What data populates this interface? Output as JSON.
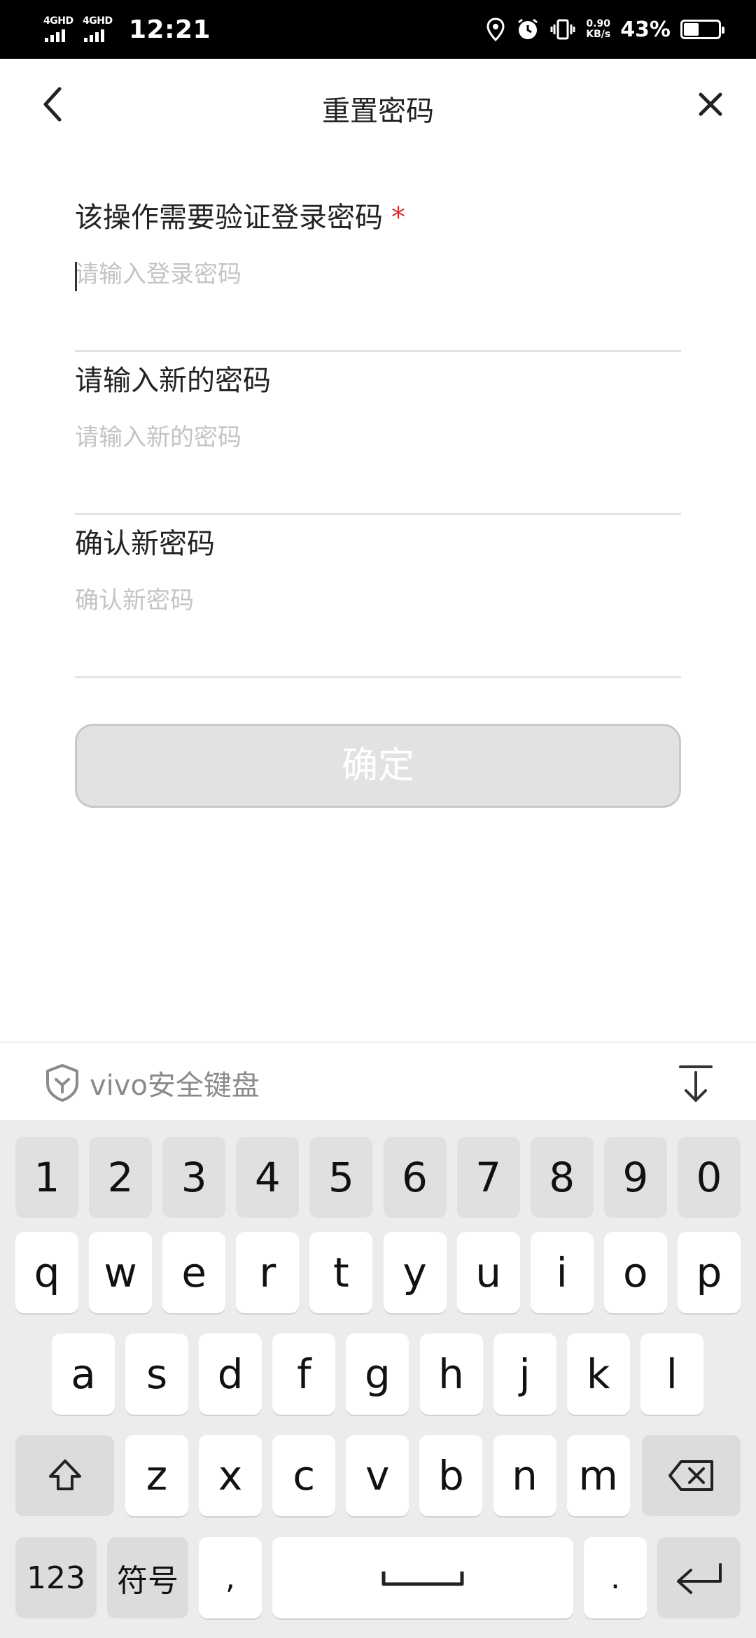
{
  "status_bar": {
    "sim1_label": "4GHD",
    "sim2_label": "4GHD",
    "time": "12:21",
    "speed_value": "0.90",
    "speed_unit": "KB/s",
    "battery_percent": "43%",
    "battery_level": 0.43,
    "icons": [
      "location-icon",
      "alarm-icon",
      "vibrate-icon"
    ]
  },
  "header": {
    "title": "重置密码",
    "back_icon": "chevron-left-icon",
    "close_icon": "close-icon"
  },
  "form": {
    "fields": [
      {
        "label": "该操作需要验证登录密码",
        "required_mark": "*",
        "placeholder": "请输入登录密码",
        "value": ""
      },
      {
        "label": "请输入新的密码",
        "placeholder": "请输入新的密码",
        "value": ""
      },
      {
        "label": "确认新密码",
        "placeholder": "确认新密码",
        "value": ""
      }
    ],
    "submit_label": "确定"
  },
  "keyboard": {
    "brand": "vivo安全键盘",
    "shield_icon": "shield-icon",
    "hide_icon": "keyboard-hide-icon",
    "row_numbers": [
      "1",
      "2",
      "3",
      "4",
      "5",
      "6",
      "7",
      "8",
      "9",
      "0"
    ],
    "row1": [
      "q",
      "w",
      "e",
      "r",
      "t",
      "y",
      "u",
      "i",
      "o",
      "p"
    ],
    "row2": [
      "a",
      "s",
      "d",
      "f",
      "g",
      "h",
      "j",
      "k",
      "l"
    ],
    "row3": [
      "z",
      "x",
      "c",
      "v",
      "b",
      "n",
      "m"
    ],
    "key_123": "123",
    "key_symbols": "符号",
    "key_comma": ",",
    "key_period": ".",
    "shift_icon": "shift-icon",
    "backspace_icon": "backspace-icon",
    "space_icon": "space-icon",
    "enter_icon": "enter-icon"
  }
}
